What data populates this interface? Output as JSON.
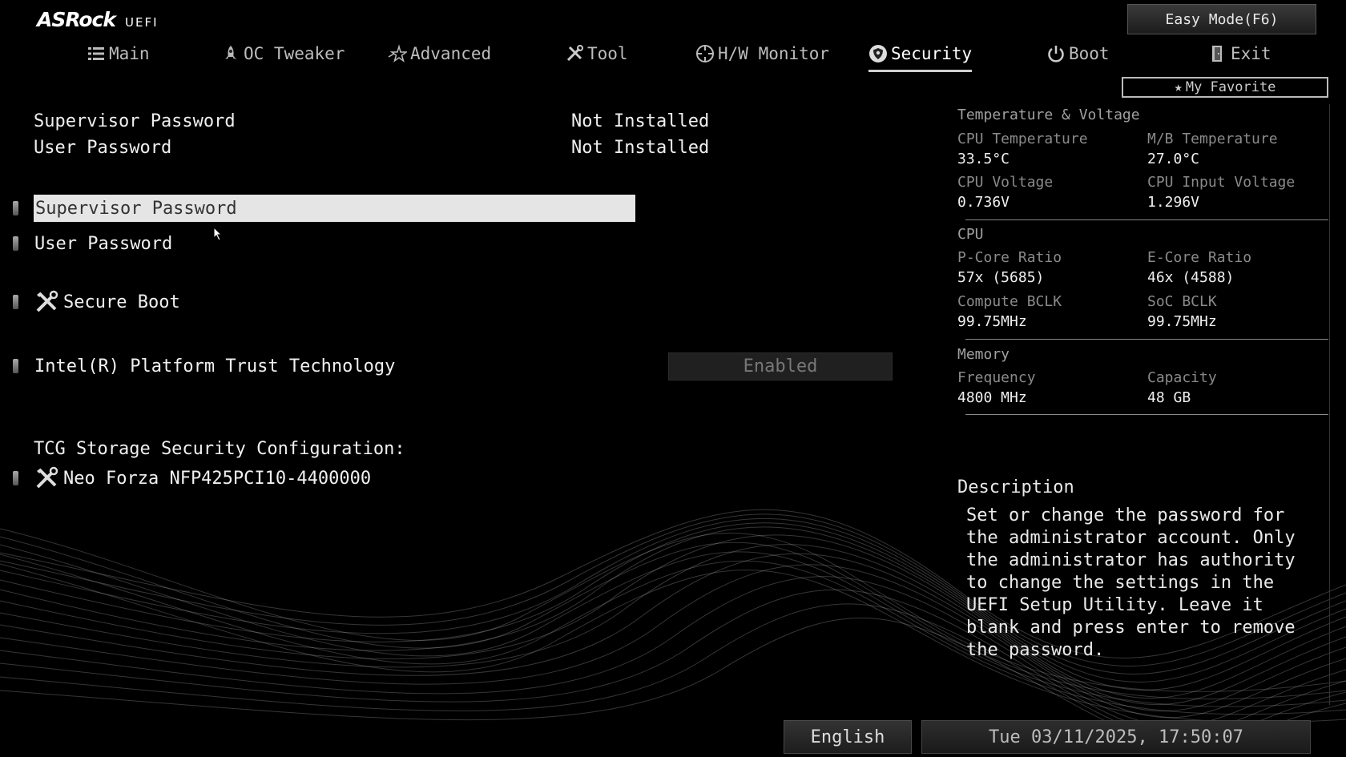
{
  "brand": {
    "name": "ASRock",
    "product": "UEFI"
  },
  "header": {
    "easy_mode_label": "Easy Mode(F6)",
    "favorite_label": "My Favorite"
  },
  "nav": {
    "tabs": [
      {
        "label": "Main",
        "icon": "list-icon"
      },
      {
        "label": "OC Tweaker",
        "icon": "rocket-icon"
      },
      {
        "label": "Advanced",
        "icon": "star-arrow-icon"
      },
      {
        "label": "Tool",
        "icon": "tools-icon"
      },
      {
        "label": "H/W Monitor",
        "icon": "crosshair-icon"
      },
      {
        "label": "Security",
        "icon": "shield-icon"
      },
      {
        "label": "Boot",
        "icon": "power-icon"
      },
      {
        "label": "Exit",
        "icon": "door-exit-icon"
      }
    ],
    "active": "Security"
  },
  "status": [
    {
      "label": "Supervisor Password",
      "value": "Not Installed"
    },
    {
      "label": "User Password",
      "value": "Not Installed"
    }
  ],
  "menu": {
    "supervisor_password": "Supervisor Password",
    "user_password": "User Password",
    "secure_boot": "Secure Boot",
    "ptt_label": "Intel(R) Platform Trust Technology",
    "ptt_value": "Enabled",
    "tcg_section": "TCG Storage Security Configuration:",
    "tcg_device": "Neo Forza NFP425PCI10-4400000"
  },
  "monitor": {
    "temp_voltage": {
      "title": "Temperature & Voltage",
      "cpu_temp_label": "CPU Temperature",
      "cpu_temp": "33.5°C",
      "mb_temp_label": "M/B Temperature",
      "mb_temp": "27.0°C",
      "cpu_voltage_label": "CPU Voltage",
      "cpu_voltage": "0.736V",
      "cpu_input_voltage_label": "CPU Input Voltage",
      "cpu_input_voltage": "1.296V"
    },
    "cpu": {
      "title": "CPU",
      "pcore_label": "P-Core Ratio",
      "pcore": "57x (5685)",
      "ecore_label": "E-Core Ratio",
      "ecore": "46x (4588)",
      "compute_bclk_label": "Compute BCLK",
      "compute_bclk": "99.75MHz",
      "soc_bclk_label": "SoC BCLK",
      "soc_bclk": "99.75MHz"
    },
    "memory": {
      "title": "Memory",
      "frequency_label": "Frequency",
      "frequency": "4800 MHz",
      "capacity_label": "Capacity",
      "capacity": "48 GB"
    }
  },
  "description": {
    "title": "Description",
    "text": "Set or change the password for the administrator account. Only the administrator has authority to change the settings in the UEFI Setup Utility. Leave it blank and press enter to remove the password."
  },
  "footer": {
    "language": "English",
    "datetime": "Tue 03/11/2025, 17:50:07"
  }
}
